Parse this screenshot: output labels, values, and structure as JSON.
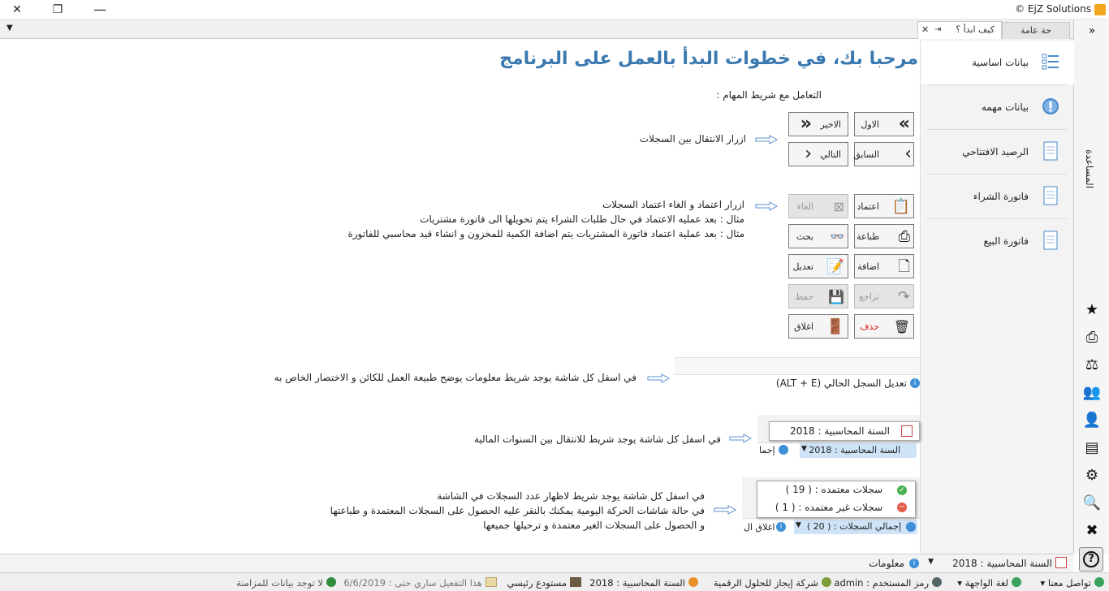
{
  "window": {
    "title": "EjZ Solutions",
    "minimize_glyph": "✕",
    "restore_glyph": "❐",
    "close_glyph": "✕"
  },
  "tabs": [
    {
      "label": "حة عامة"
    },
    {
      "label": "كيف ابدأ ؟"
    }
  ],
  "heading": "مرحبا بك، في خطوات البدأ بالعمل على البرنامج",
  "section_taskbar": "التعامل مع شريط المهام :",
  "nav": {
    "items": [
      {
        "label": "بيانات اساسية",
        "icon": "list-icon"
      },
      {
        "label": "بيانات مهمه",
        "icon": "info-icon"
      },
      {
        "label": "الرصيد الافتتاحي",
        "icon": "document-icon"
      },
      {
        "label": "فاتورة الشراء",
        "icon": "document-icon"
      },
      {
        "label": "فاتورة البيع",
        "icon": "document-icon"
      }
    ]
  },
  "rail": {
    "help_label": "المساعدة",
    "icons": [
      "star-icon",
      "printer-stack-icon",
      "scales-icon",
      "people-icon",
      "person-icon",
      "register-icon",
      "gear-icon",
      "search-doc-icon",
      "tools-icon",
      "help-icon"
    ]
  },
  "nav_buttons": {
    "first": "الاول",
    "last": "الاخير",
    "prev": "السابق",
    "next": "التالي",
    "desc": "ازرار الانتقال بين السجلات"
  },
  "approve": {
    "approve": "اعتماد",
    "cancel": "الغاء",
    "print": "طباعة",
    "search": "بحث",
    "add": "اضافة",
    "edit": "تعديل",
    "undo": "تراجع",
    "save": "حفظ",
    "delete": "حذف",
    "close": "اغلاق",
    "desc1": "ازرار اعتماد و الغاء اعتماد السجلات",
    "desc2": "مثال : بعد عمليه الاعتماد في حال طلبات الشراء يتم تحويلها الى فاتورة مشتريات",
    "desc3": "مثال : بعد عملية اعتماد فاتورة المشتريات يتم اضافة الكمية للمخزون و انشاء قيد محاسبي للفاتورة"
  },
  "info_strip": {
    "desc": "في اسفل كل شاشة يوجد شريط معلومات يوضح طبيعة العمل للكائن و الاختصار الخاص به",
    "text": "تعديل السجل الحالي (ALT + E)"
  },
  "year_strip": {
    "desc": "في اسفل كل شاشة يوجد شريط للانتقال بين السنوات المالية",
    "popup": "السنة المحاسبية : 2018",
    "bar": "السنة المحاسبية : 2018",
    "cut": "إجما"
  },
  "records_strip": {
    "desc1": "في اسفل كل شاشة يوجد شريط لاظهار عدد السجلات في الشاشة",
    "desc2": "في حالة شاشات الحركة اليومية يمكنك بالنقر عليه الحصول على السجلات المعتمدة و طباعتها",
    "desc3": "و الحصول على السجلات الغير معتمدة و ترحيلها جميعها",
    "approved": "سجلات معتمده : ( 19 )",
    "unapproved": "سجلات غير معتمده : ( 1 )",
    "total": "إجمالي السجلات : ( 20 )",
    "close_cut": "اغلاق ال"
  },
  "infobar": {
    "year": "السنة المحاسبية : 2018",
    "info": "معلومات"
  },
  "statusbar": {
    "contact": "تواصل معنا",
    "language": "لغة الواجهة",
    "user": "رمز المستخدم : admin",
    "company": "شركة إيجاز للحلول الرقمية",
    "year": "السنة المحاسبية : 2018",
    "warehouse": "مستودع رئيسي",
    "activation": "هذا التفعيل ساري حتى : 6/6/2019",
    "sync": "لا توجد بيانات للمزامنة"
  },
  "colors": {
    "heading": "#3a78b0",
    "accent_green": "#4caf50",
    "accent_red": "#e55a4a",
    "info_blue": "#3d8fd8"
  }
}
